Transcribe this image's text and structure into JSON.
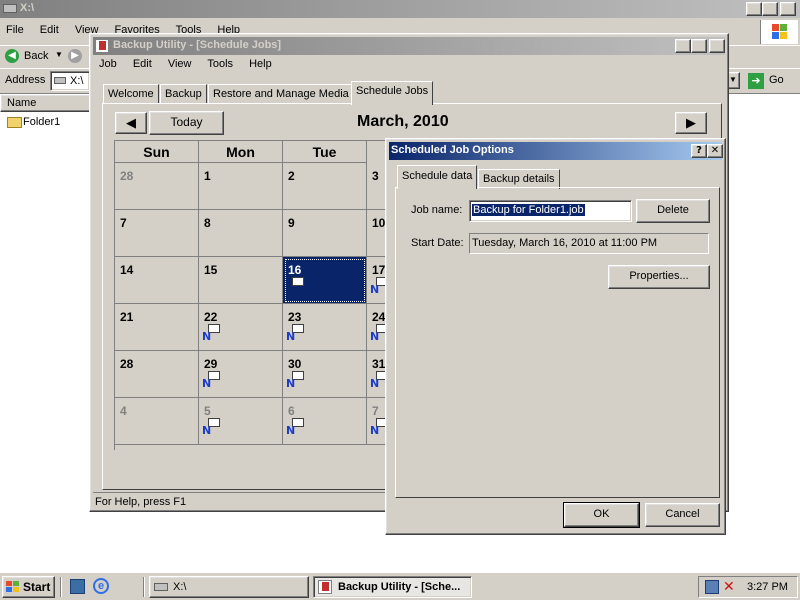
{
  "explorer": {
    "title": "X:\\",
    "menu": [
      "File",
      "Edit",
      "View",
      "Favorites",
      "Tools",
      "Help"
    ],
    "back_label": "Back",
    "address_label": "Address",
    "address_value": "X:\\",
    "go_label": "Go",
    "column_name": "Name",
    "items": [
      "Folder1"
    ]
  },
  "backup": {
    "title": "Backup Utility - [Schedule Jobs]",
    "menu": [
      "Job",
      "Edit",
      "View",
      "Tools",
      "Help"
    ],
    "tabs": [
      "Welcome",
      "Backup",
      "Restore and Manage Media",
      "Schedule Jobs"
    ],
    "today_label": "Today",
    "month_title": "March, 2010",
    "weekdays": [
      "Sun",
      "Mon",
      "Tue"
    ],
    "weeks": [
      [
        "28",
        "1",
        "2",
        "3"
      ],
      [
        "7",
        "8",
        "9",
        "10"
      ],
      [
        "14",
        "15",
        "16",
        "17"
      ],
      [
        "21",
        "22",
        "23",
        "24"
      ],
      [
        "28",
        "29",
        "30",
        "31"
      ],
      [
        "4",
        "5",
        "6",
        "7"
      ]
    ],
    "status": "For Help, press F1"
  },
  "dialog": {
    "title": "Scheduled Job Options",
    "help_btn": "?",
    "close_btn": "✕",
    "tabs": [
      "Schedule data",
      "Backup details"
    ],
    "job_name_label": "Job name:",
    "job_name_value": "Backup for Folder1.job",
    "delete_label": "Delete",
    "start_date_label": "Start Date:",
    "start_date_value": "Tuesday, March 16, 2010 at 11:00 PM",
    "properties_label": "Properties...",
    "ok_label": "OK",
    "cancel_label": "Cancel"
  },
  "taskbar": {
    "start_label": "Start",
    "tasks": [
      "X:\\",
      "Backup Utility - [Sche..."
    ],
    "clock": "3:27 PM"
  },
  "colors": {
    "face": "#d4d0c8",
    "title_active": "#0a246a",
    "selected_day": "#0a246a"
  }
}
